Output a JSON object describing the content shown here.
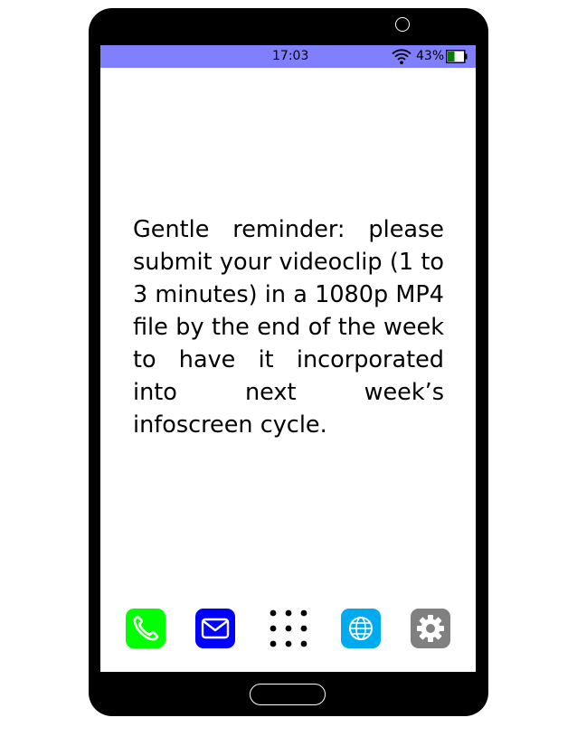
{
  "status_bar": {
    "time": "17:03",
    "battery_percent": "43%",
    "battery_level": 0.43,
    "wifi_icon": "wifi-icon",
    "background_color": "#8080ff"
  },
  "message": {
    "text": "Gentle reminder: please submit your videoclip (1 to 3 minutes) in a 1080p MP4 file by the end of the week to have it incorporated into next week’s infoscreen cycle."
  },
  "dock": {
    "apps": [
      {
        "icon": "phone-icon",
        "color": "#00ff00"
      },
      {
        "icon": "mail-icon",
        "color": "#0000ff"
      },
      {
        "icon": "app-grid-icon",
        "color": "#000000"
      },
      {
        "icon": "browser-icon",
        "color": "#00aaee"
      },
      {
        "icon": "settings-icon",
        "color": "#808080"
      }
    ]
  }
}
